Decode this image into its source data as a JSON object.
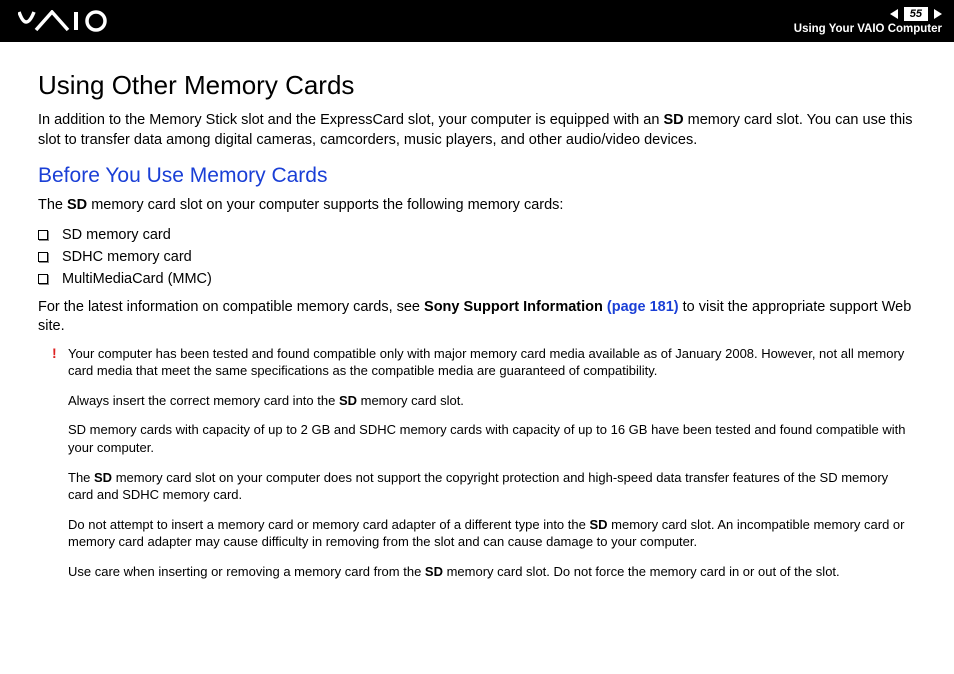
{
  "header": {
    "page_number": "55",
    "section": "Using Your VAIO Computer"
  },
  "title": "Using Other Memory Cards",
  "intro_pre": "In addition to the Memory Stick slot and the ExpressCard slot, your computer is equipped with an ",
  "intro_bold": "SD",
  "intro_post": " memory card slot. You can use this slot to transfer data among digital cameras, camcorders, music players, and other audio/video devices.",
  "subhead": "Before You Use Memory Cards",
  "supports_pre": "The ",
  "supports_bold": "SD",
  "supports_post": " memory card slot on your computer supports the following memory cards:",
  "bullets": [
    "SD memory card",
    "SDHC memory card",
    "MultiMediaCard (MMC)"
  ],
  "latest_pre": "For the latest information on compatible memory cards, see ",
  "latest_bold": "Sony Support Information ",
  "latest_link": "(page 181)",
  "latest_post": " to visit the appropriate support Web site.",
  "bang": "!",
  "notes": {
    "n1": "Your computer has been tested and found compatible only with major memory card media available as of January 2008. However, not all memory card media that meet the same specifications as the compatible media are guaranteed of compatibility.",
    "n2_pre": "Always insert the correct memory card into the ",
    "n2_bold": "SD",
    "n2_post": " memory card slot.",
    "n3": "SD memory cards with capacity of up to 2 GB and SDHC memory cards with capacity of up to 16 GB have been tested and found compatible with your computer.",
    "n4_pre": "The ",
    "n4_bold": "SD",
    "n4_post": " memory card slot on your computer does not support the copyright protection and high-speed data transfer features of the SD memory card and SDHC memory card.",
    "n5_pre": "Do not attempt to insert a memory card or memory card adapter of a different type into the ",
    "n5_bold": "SD",
    "n5_post": " memory card slot. An incompatible memory card or memory card adapter may cause difficulty in removing from the slot and can cause damage to your computer.",
    "n6_pre": "Use care when inserting or removing a memory card from the ",
    "n6_bold": "SD",
    "n6_post": " memory card slot. Do not force the memory card in or out of the slot."
  }
}
